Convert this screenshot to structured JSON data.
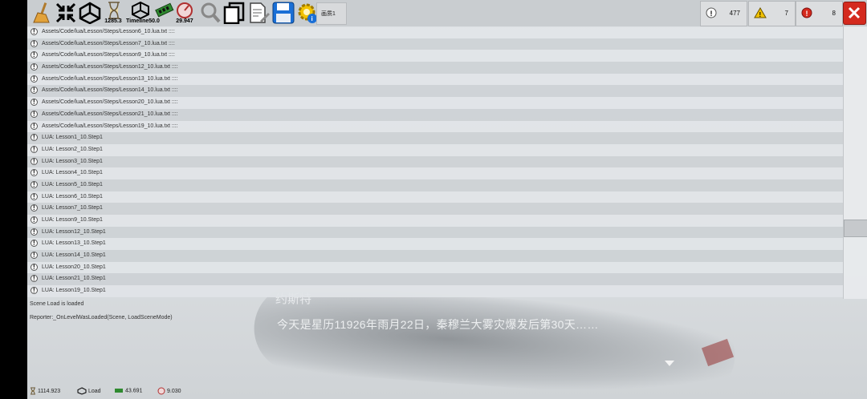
{
  "toolbar": {
    "time_value": "1285.3",
    "timeline_value": "Timeline50.0",
    "fps_value": "29.947",
    "tab_label": "画质1"
  },
  "counters": {
    "log": "477",
    "warning": "7",
    "error": "8"
  },
  "log_rows": [
    "Assets/Code/lua/Lesson/Steps/Lesson6_10.lua.txt ::::",
    "Assets/Code/lua/Lesson/Steps/Lesson7_10.lua.txt ::::",
    "Assets/Code/lua/Lesson/Steps/Lesson9_10.lua.txt ::::",
    "Assets/Code/lua/Lesson/Steps/Lesson12_10.lua.txt ::::",
    "Assets/Code/lua/Lesson/Steps/Lesson13_10.lua.txt ::::",
    "Assets/Code/lua/Lesson/Steps/Lesson14_10.lua.txt ::::",
    "Assets/Code/lua/Lesson/Steps/Lesson20_10.lua.txt ::::",
    "Assets/Code/lua/Lesson/Steps/Lesson21_10.lua.txt ::::",
    "Assets/Code/lua/Lesson/Steps/Lesson19_10.lua.txt ::::",
    "LUA: Lesson1_10.Step1",
    "LUA: Lesson2_10.Step1",
    "LUA: Lesson3_10.Step1",
    "LUA: Lesson4_10.Step1",
    "LUA: Lesson5_10.Step1",
    "LUA: Lesson6_10.Step1",
    "LUA: Lesson7_10.Step1",
    "LUA: Lesson9_10.Step1",
    "LUA: Lesson12_10.Step1",
    "LUA: Lesson13_10.Step1",
    "LUA: Lesson14_10.Step1",
    "LUA: Lesson20_10.Step1",
    "LUA: Lesson21_10.Step1",
    "LUA: Lesson19_10.Step1"
  ],
  "detail": {
    "line1": "Scene Load is loaded",
    "line2": "Reporter:_OnLevelWasLoaded(Scene, LoadSceneMode)"
  },
  "scene": {
    "speaker": "约斯特",
    "dialogue": "今天是星历11926年雨月22日，秦穆兰大雾灾爆发后第30天……"
  },
  "status": {
    "time": "1114.923",
    "scene": "Load",
    "memory": "43.691",
    "fps": "9.030"
  },
  "colors": {
    "error_red": "#d42a1e",
    "warning_yellow": "#f2c200",
    "save_blue": "#1a6fd6"
  }
}
